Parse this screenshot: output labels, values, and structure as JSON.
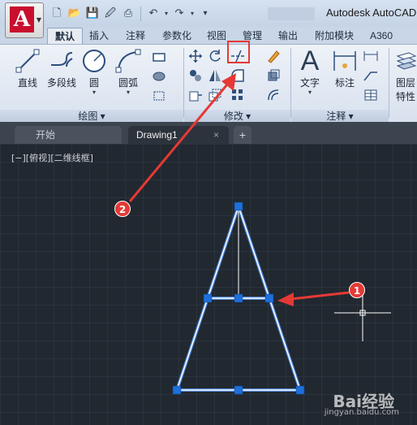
{
  "window": {
    "title": "Autodesk AutoCAD"
  },
  "app_menu": {
    "logo": "A"
  },
  "quick_access": [
    "new-icon",
    "open-icon",
    "save-icon",
    "saveas-icon",
    "print-icon",
    "undo-icon",
    "redo-icon",
    "customize-icon"
  ],
  "ribbon_tabs": [
    {
      "label": "默认",
      "active": true
    },
    {
      "label": "插入"
    },
    {
      "label": "注释"
    },
    {
      "label": "参数化"
    },
    {
      "label": "视图"
    },
    {
      "label": "管理"
    },
    {
      "label": "输出"
    },
    {
      "label": "附加模块"
    },
    {
      "label": "A360"
    }
  ],
  "panels": {
    "draw": {
      "title": "绘图",
      "tools": [
        "直线",
        "多段线",
        "圆",
        "圆弧"
      ]
    },
    "modify": {
      "title": "修改"
    },
    "annotation": {
      "title": "注释",
      "tools": [
        "文字",
        "标注"
      ]
    },
    "layers": {
      "label_line1": "图层",
      "label_line2": "特性"
    }
  },
  "doc_tabs": {
    "start": "开始",
    "drawing": "Drawing1",
    "close": "×",
    "new": "+"
  },
  "viewport_label": "[−][俯视][二维线框]",
  "callouts": [
    "1",
    "2"
  ],
  "watermark": {
    "logo": "Bai经验",
    "url": "jingyan.baidu.com"
  },
  "colors": {
    "accent_red": "#e53935",
    "canvas": "#212830",
    "grip_blue": "#1e6fd9",
    "line_white": "#ffffff"
  }
}
